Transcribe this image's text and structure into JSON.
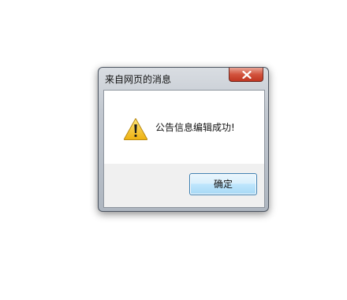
{
  "dialog": {
    "title": "来自网页的消息",
    "message": "公告信息编辑成功!",
    "ok_label": "确定",
    "icon": "warning-icon",
    "close_icon": "close-icon"
  },
  "colors": {
    "close_button": "#c7432d",
    "warning_yellow": "#f2c21b",
    "button_border": "#3c7fb1"
  }
}
